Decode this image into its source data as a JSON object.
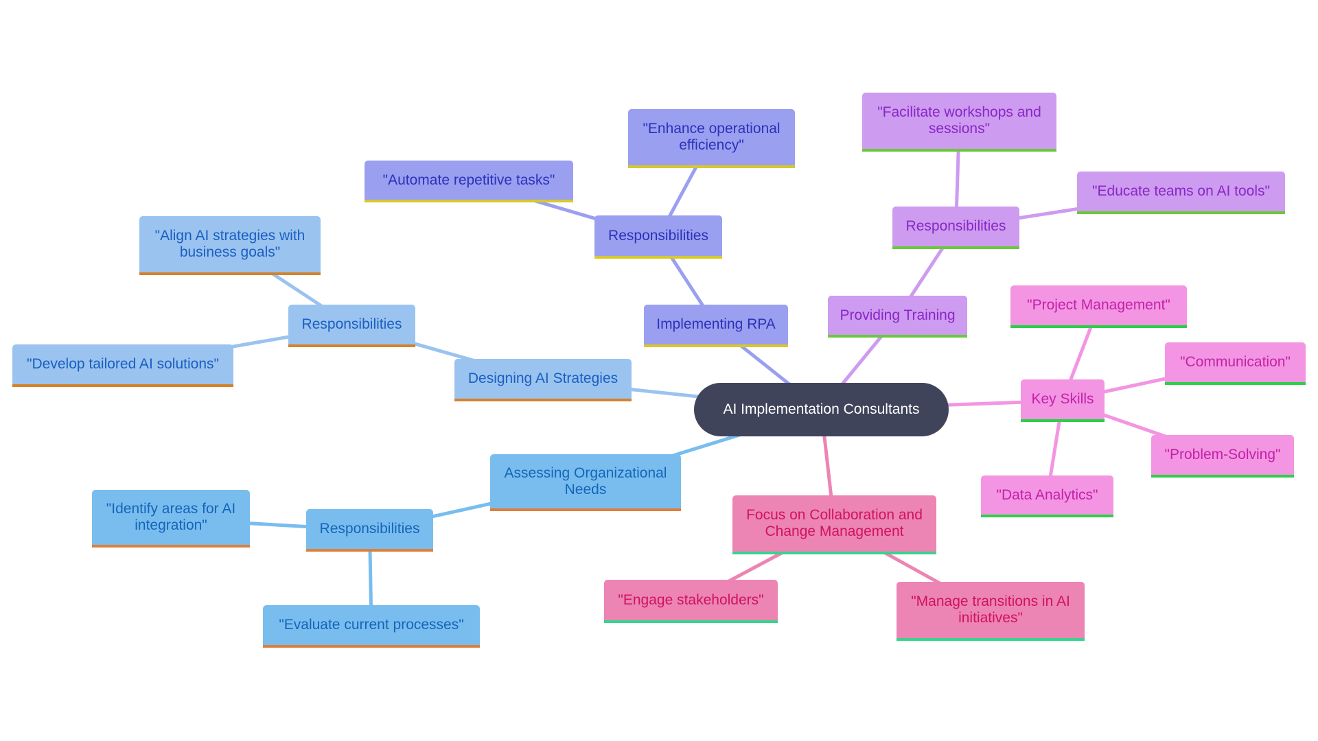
{
  "diagram": {
    "type": "mindmap",
    "root": {
      "id": "root",
      "label": "AI Implementation Consultants"
    },
    "colors": {
      "root_bg": "#40445a",
      "root_text": "#ffffff",
      "blue1": "#9ac3ef",
      "blue2": "#79bdef",
      "indigo": "#9b9ff0",
      "purple": "#cd9bef",
      "pink": "#f395e2",
      "rose": "#ec85b3",
      "edge_blue1": "#9ac3ef",
      "edge_blue2": "#79bdef",
      "edge_indigo": "#9b9ff0",
      "edge_purple": "#cd9bef",
      "edge_pink": "#f395e2",
      "edge_rose": "#ec85b3"
    },
    "nodes": [
      {
        "id": "designing",
        "label": "Designing AI Strategies",
        "parent": "root"
      },
      {
        "id": "resp-design",
        "label": "Responsibilities",
        "parent": "designing"
      },
      {
        "id": "align",
        "label": "\"Align AI strategies with business goals\"",
        "parent": "resp-design"
      },
      {
        "id": "develop",
        "label": "\"Develop tailored AI solutions\"",
        "parent": "resp-design"
      },
      {
        "id": "rpa",
        "label": "Implementing RPA",
        "parent": "root"
      },
      {
        "id": "resp-rpa",
        "label": "Responsibilities",
        "parent": "rpa"
      },
      {
        "id": "automate",
        "label": "\"Automate repetitive tasks\"",
        "parent": "resp-rpa"
      },
      {
        "id": "enhance",
        "label": "\"Enhance operational efficiency\"",
        "parent": "resp-rpa"
      },
      {
        "id": "training",
        "label": "Providing Training",
        "parent": "root"
      },
      {
        "id": "resp-train",
        "label": "Responsibilities",
        "parent": "training"
      },
      {
        "id": "facilitate",
        "label": "\"Facilitate workshops and sessions\"",
        "parent": "resp-train"
      },
      {
        "id": "educate",
        "label": "\"Educate teams on AI tools\"",
        "parent": "resp-train"
      },
      {
        "id": "skills",
        "label": "Key Skills",
        "parent": "root"
      },
      {
        "id": "pm",
        "label": "\"Project Management\"",
        "parent": "skills"
      },
      {
        "id": "comm",
        "label": "\"Communication\"",
        "parent": "skills"
      },
      {
        "id": "problem",
        "label": "\"Problem-Solving\"",
        "parent": "skills"
      },
      {
        "id": "data",
        "label": "\"Data Analytics\"",
        "parent": "skills"
      },
      {
        "id": "focus",
        "label": "Focus on Collaboration and Change Management",
        "parent": "root"
      },
      {
        "id": "engage",
        "label": "\"Engage stakeholders\"",
        "parent": "focus"
      },
      {
        "id": "manage",
        "label": "\"Manage transitions in AI initiatives\"",
        "parent": "focus"
      },
      {
        "id": "assessing",
        "label": "Assessing Organizational Needs",
        "parent": "root"
      },
      {
        "id": "resp-assess",
        "label": "Responsibilities",
        "parent": "assessing"
      },
      {
        "id": "identify",
        "label": "\"Identify areas for AI integration\"",
        "parent": "resp-assess"
      },
      {
        "id": "evaluate",
        "label": "\"Evaluate current processes\"",
        "parent": "resp-assess"
      }
    ]
  }
}
